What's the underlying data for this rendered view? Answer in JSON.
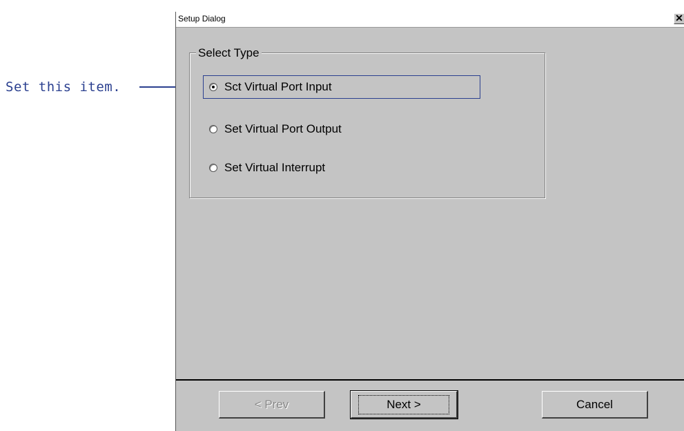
{
  "annotation": {
    "text": "Set this item."
  },
  "dialog": {
    "title": "Setup Dialog",
    "close_label": "✕",
    "group": {
      "label": "Select Type",
      "options": [
        {
          "label": "Sct Virtual Port Input",
          "checked": true
        },
        {
          "label": "Set Virtual Port Output",
          "checked": false
        },
        {
          "label": "Set Virtual Interrupt",
          "checked": false
        }
      ]
    },
    "buttons": {
      "prev_label": "< Prev",
      "next_label": "Next >",
      "cancel_label": "Cancel"
    }
  }
}
